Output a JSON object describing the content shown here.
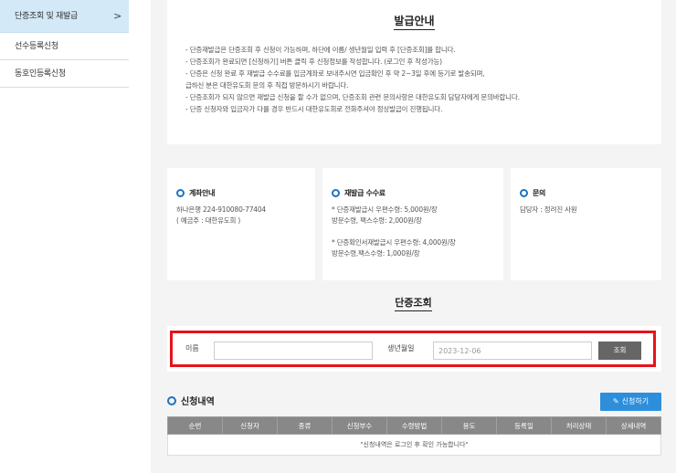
{
  "sidebar": {
    "items": [
      {
        "label": "단증조회 및 재발급",
        "active": true
      },
      {
        "label": "선수등록신청",
        "active": false
      },
      {
        "label": "동호인등록신청",
        "active": false
      }
    ]
  },
  "notice": {
    "title": "발급안내",
    "lines": [
      "- 단증재발급은 단증조회 후 신청이 가능하며, 하단에 이름/ 생년월일 입력 후 [단증조회]를 합니다.",
      "- 단증조회가 완료되면 [신청하기] 버튼 클릭 후 신청정보를 작성합니다. (로그인 후 작성가능)",
      "- 단증은 신청 완료 후 재발급 수수료를 입금계좌로 보내주시면 입금확인 후 약 2~3일 후에 등기로 발송되며,",
      "   급하신 분은 대한유도회 문의 후 직접 방문하시기 바랍니다.",
      "- 단증조회가 되지 않으면 재발급 신청을 할 수가 없으며, 단증조회 관련 문의사항은 대한유도회 담당자에게 문의바랍니다.",
      "- 단증 신청자와 입금자가 다를 경우 반드시 대한유도회로 전화주셔야 정상발급이 진행됩니다."
    ]
  },
  "cards": {
    "account": {
      "title": "계좌안내",
      "line1": "하나은행 224-910080-77404",
      "line2": "( 예금주 : 대한유도회 )"
    },
    "fee": {
      "title": "재발급 수수료",
      "line1": "* 단증재발급시 우편수령: 5,000원/장",
      "line2": "방문수령, 팩스수령: 2,000원/장",
      "line3": "* 단증확인서재발급시 우편수령: 4,000원/장",
      "line4": "방문수령,팩스수령: 1,000원/장"
    },
    "contact": {
      "title": "문의",
      "line1": "담당자 : 정려진 사원"
    }
  },
  "search": {
    "title": "단증조회",
    "name_label": "이름",
    "name_value": "",
    "birth_label": "생년월일",
    "birth_value": "2023-12-06",
    "button": "조회"
  },
  "applications": {
    "title": "신청내역",
    "apply_button": "신청하기",
    "columns": [
      "순번",
      "신청자",
      "종류",
      "신청부수",
      "수령방법",
      "용도",
      "등록일",
      "처리상태",
      "상세내역"
    ],
    "empty_message": "\"신청내역은 로그인 후 확인 가능합니다\""
  }
}
